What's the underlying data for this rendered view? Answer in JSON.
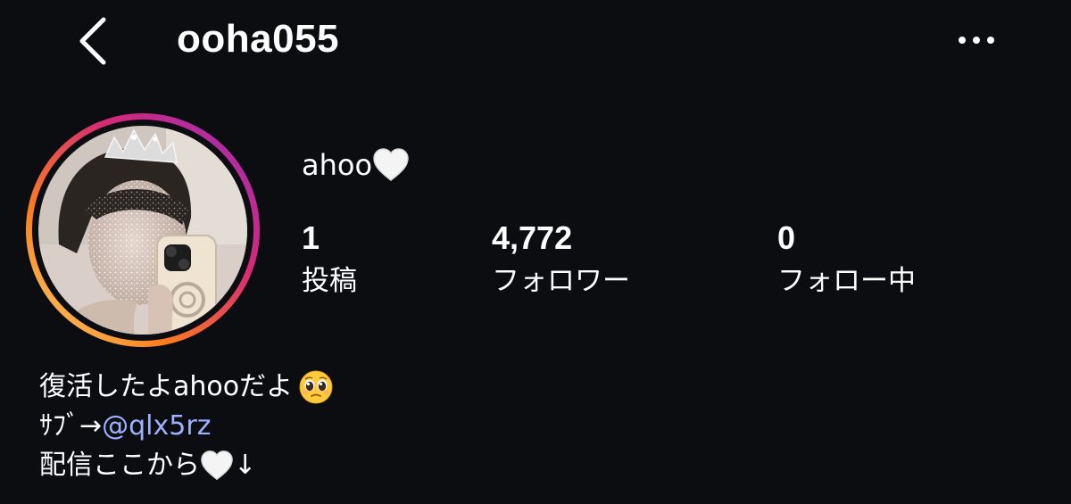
{
  "header": {
    "username": "ooha055",
    "back_icon": "chevron-left-icon",
    "more_icon": "more-horizontal-icon"
  },
  "profile": {
    "display_name": "ahoo",
    "display_name_icon": "white-heart-icon",
    "avatar_ring_colors": [
      "#d62976",
      "#962fbf",
      "#fa7e1e",
      "#feda75"
    ],
    "stats": {
      "posts": {
        "value": "1",
        "label": "投稿"
      },
      "followers": {
        "value": "4,772",
        "label": "フォロワー"
      },
      "following": {
        "value": "0",
        "label": "フォロー中"
      }
    }
  },
  "bio": {
    "line1_text": "復活したよahooだよ",
    "line1_icon": "pleading-face-emoji-icon",
    "line2_prefix": "ｻﾌﾞ→",
    "line2_mention": "@qlx5rz",
    "line3_text": "配信ここから",
    "line3_icon": "white-heart-icon",
    "line3_suffix": "↓",
    "mention_color": "#9db1ff"
  }
}
